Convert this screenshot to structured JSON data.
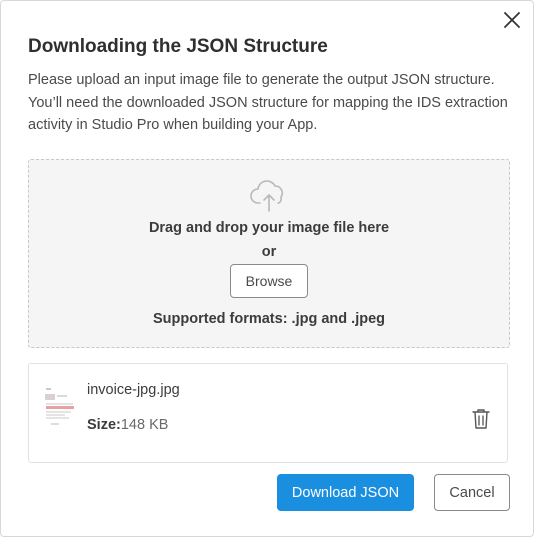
{
  "dialog": {
    "title": "Downloading the JSON Structure",
    "description": "Please upload an input image file to generate the output JSON structure. You’ll need the downloaded JSON structure for mapping the IDS extraction activity in Studio Pro when building your App.",
    "close_icon": "close-icon"
  },
  "dropzone": {
    "icon": "cloud-upload-icon",
    "drag_text": "Drag and drop your image file here",
    "or_text": "or",
    "browse_label": "Browse",
    "formats_text": "Supported formats: .jpg and .jpeg"
  },
  "file": {
    "thumbnail_icon": "document-thumbnail-icon",
    "name": "invoice-jpg.jpg",
    "size_label": "Size:",
    "size_value": "148 KB",
    "delete_icon": "trash-icon"
  },
  "actions": {
    "download_label": "Download JSON",
    "cancel_label": "Cancel"
  },
  "colors": {
    "primary": "#1a8fe0",
    "dropzone_bg": "#f5f5f5",
    "border": "#c8c8c8"
  }
}
